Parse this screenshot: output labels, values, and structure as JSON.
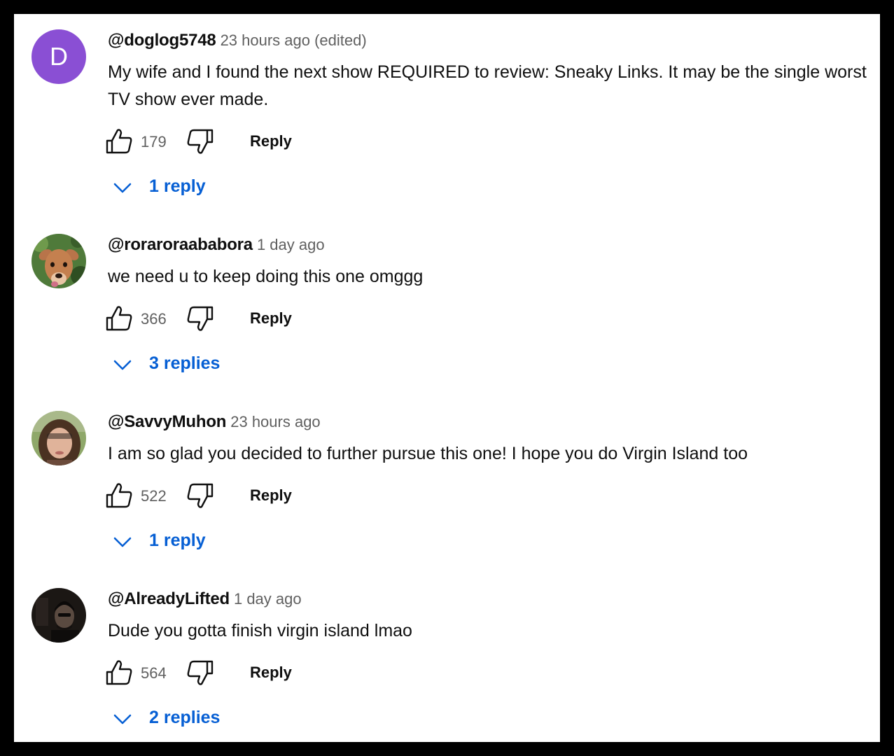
{
  "colors": {
    "page_background": "#000000",
    "card_background": "#ffffff",
    "replies_link": "#065fd4",
    "meta_text": "#606060",
    "primary_text": "#0f0f0f",
    "avatar_d_background": "#8a4fd4"
  },
  "icons": {
    "like": "thumbs-up-icon",
    "dislike": "thumbs-down-icon",
    "expand": "chevron-down-icon"
  },
  "comments": [
    {
      "author": "@doglog5748",
      "time": "23 hours ago (edited)",
      "avatar_letter": "D",
      "text": "My wife and I found the next show REQUIRED to review: Sneaky Links. It may be the single worst TV show ever made.",
      "likes": "179",
      "reply_label": "Reply",
      "replies_label": "1 reply"
    },
    {
      "author": "@roraroraababora",
      "time": "1 day ago",
      "avatar_letter": "",
      "text": "we need u to keep doing this one omggg",
      "likes": "366",
      "reply_label": "Reply",
      "replies_label": "3 replies"
    },
    {
      "author": "@SavvyMuhon",
      "time": "23 hours ago",
      "avatar_letter": "",
      "text": "I am so glad you decided to further pursue this one! I hope you do Virgin Island too",
      "likes": "522",
      "reply_label": "Reply",
      "replies_label": "1 reply"
    },
    {
      "author": "@AlreadyLifted",
      "time": "1 day ago",
      "avatar_letter": "",
      "text": "Dude you gotta finish virgin island lmao",
      "likes": "564",
      "reply_label": "Reply",
      "replies_label": "2 replies"
    }
  ]
}
